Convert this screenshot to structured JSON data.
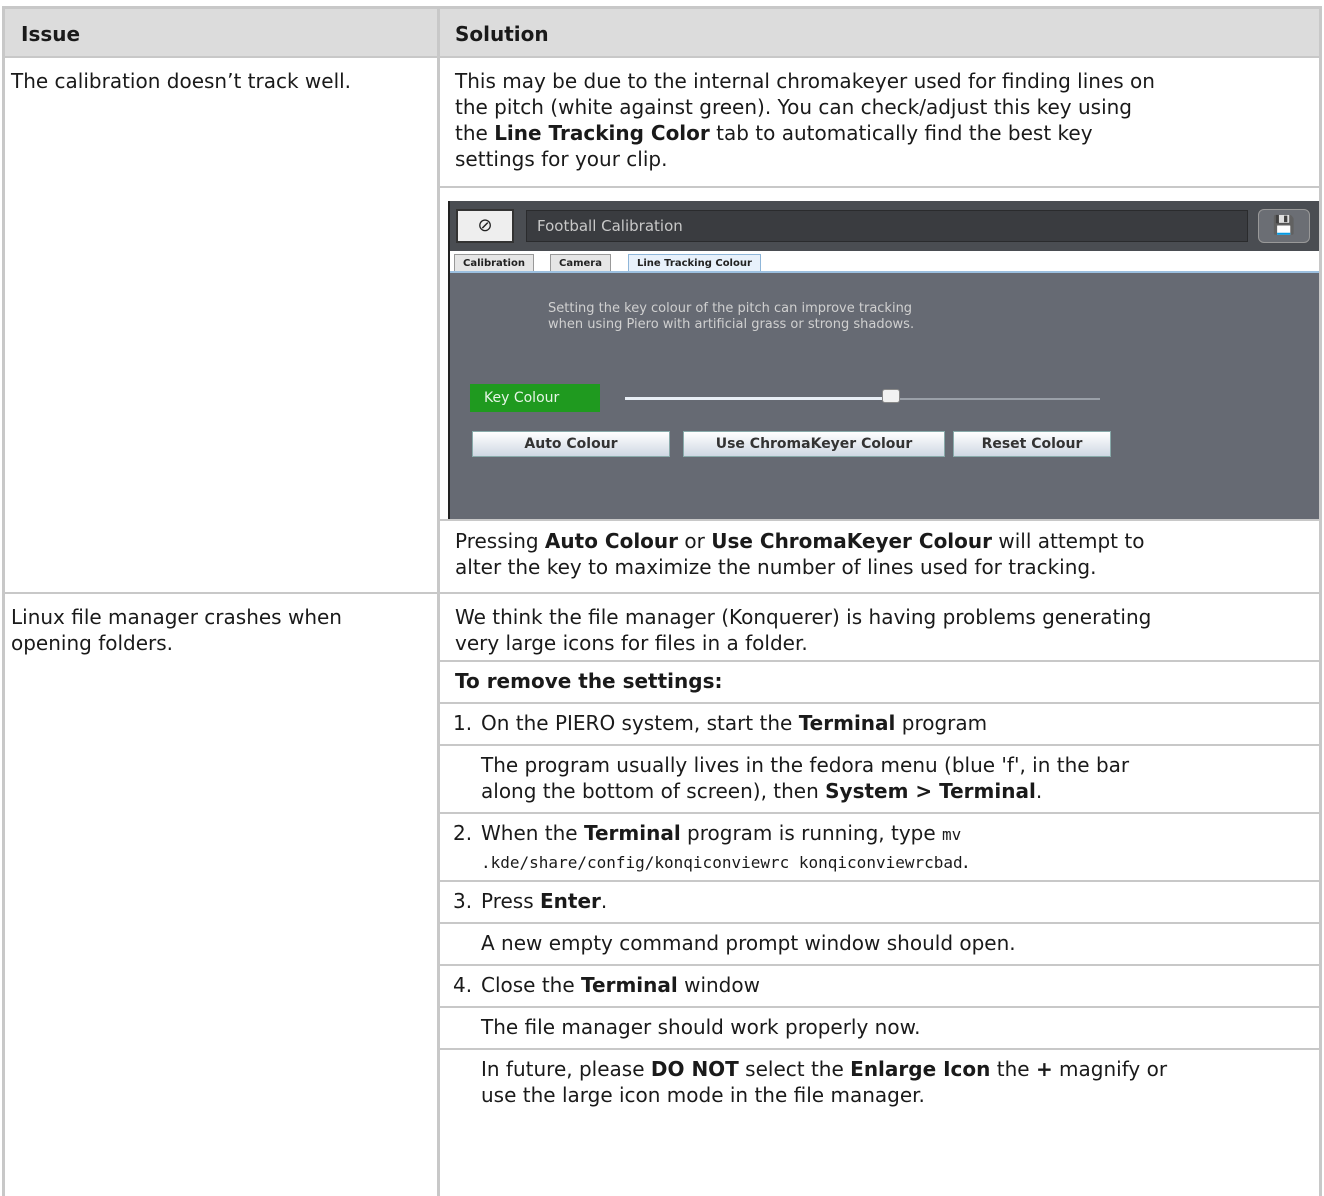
{
  "header": {
    "col1": "Issue",
    "col2": "Solution"
  },
  "row1": {
    "issue": "The calibration doesn’t track well.",
    "p1_line1": "This may be due to the internal chromakeyer used for finding lines on",
    "p1_line2": "the pitch (white against green). You can check/adjust this key using",
    "p1_line3_pre": "the ",
    "p1_line3_bold": "Line Tracking Color",
    "p1_line3_post": " tab to automatically find the best key",
    "p1_line4": "settings for your clip.",
    "screenshot": {
      "logo": "⊘",
      "title": "Football Calibration",
      "save_icon": "💾",
      "tabs": [
        "Calibration",
        "Camera",
        "Line Tracking Colour"
      ],
      "msg_line1": "Setting the key colour of the pitch can improve tracking",
      "msg_line2": "when using Piero with artificial grass or strong shadows.",
      "key_colour_label": "Key Colour",
      "slider_value": 0.56,
      "buttons": [
        "Auto Colour",
        "Use ChromaKeyer Colour",
        "Reset Colour"
      ]
    },
    "p2_pre": "Pressing ",
    "p2_b1": "Auto Colour",
    "p2_mid": " or ",
    "p2_b2": "Use ChromaKeyer Colour",
    "p2_post": " will attempt to",
    "p2_line2": "alter the key to maximize the number of lines used for tracking."
  },
  "row2": {
    "issue_line1": "Linux file manager crashes when",
    "issue_line2": "opening folders.",
    "intro_line1": "We think the file manager (Konquerer) is having problems generating",
    "intro_line2": "very large icons for files in a folder.",
    "heading": "To remove the settings:",
    "step1_num": "1.",
    "step1_pre": "On the PIERO system, start the ",
    "step1_bold": "Terminal",
    "step1_post": " program",
    "step1_note_line1": "The program usually lives in the fedora menu (blue 'f', in the bar",
    "step1_note_line2_pre": "along the bottom of screen), then ",
    "step1_note_line2_bold": "System > Terminal",
    "step1_note_line2_post": ".",
    "step2_num": "2.",
    "step2_pre": "When the ",
    "step2_bold": "Terminal",
    "step2_mid": " program is running, type ",
    "step2_code1": "mv",
    "step2_code2": ".kde/share/config/konqiconviewrc konqiconviewrcbad",
    "step2_post": ".",
    "step3_num": "3.",
    "step3_pre": "Press ",
    "step3_bold": "Enter",
    "step3_post": ".",
    "step3_note": "A new empty command prompt window should open.",
    "step4_num": "4.",
    "step4_pre": "Close the ",
    "step4_bold": "Terminal",
    "step4_post": " window",
    "step4_note": "The file manager should work properly now.",
    "final_pre": "In future, please ",
    "final_b1": "DO NOT",
    "final_mid1": " select the ",
    "final_b2": "Enlarge Icon",
    "final_mid2": " the ",
    "final_b3": "+",
    "final_post": " magnify or",
    "final_line2": "use the large icon mode in the file manager."
  }
}
